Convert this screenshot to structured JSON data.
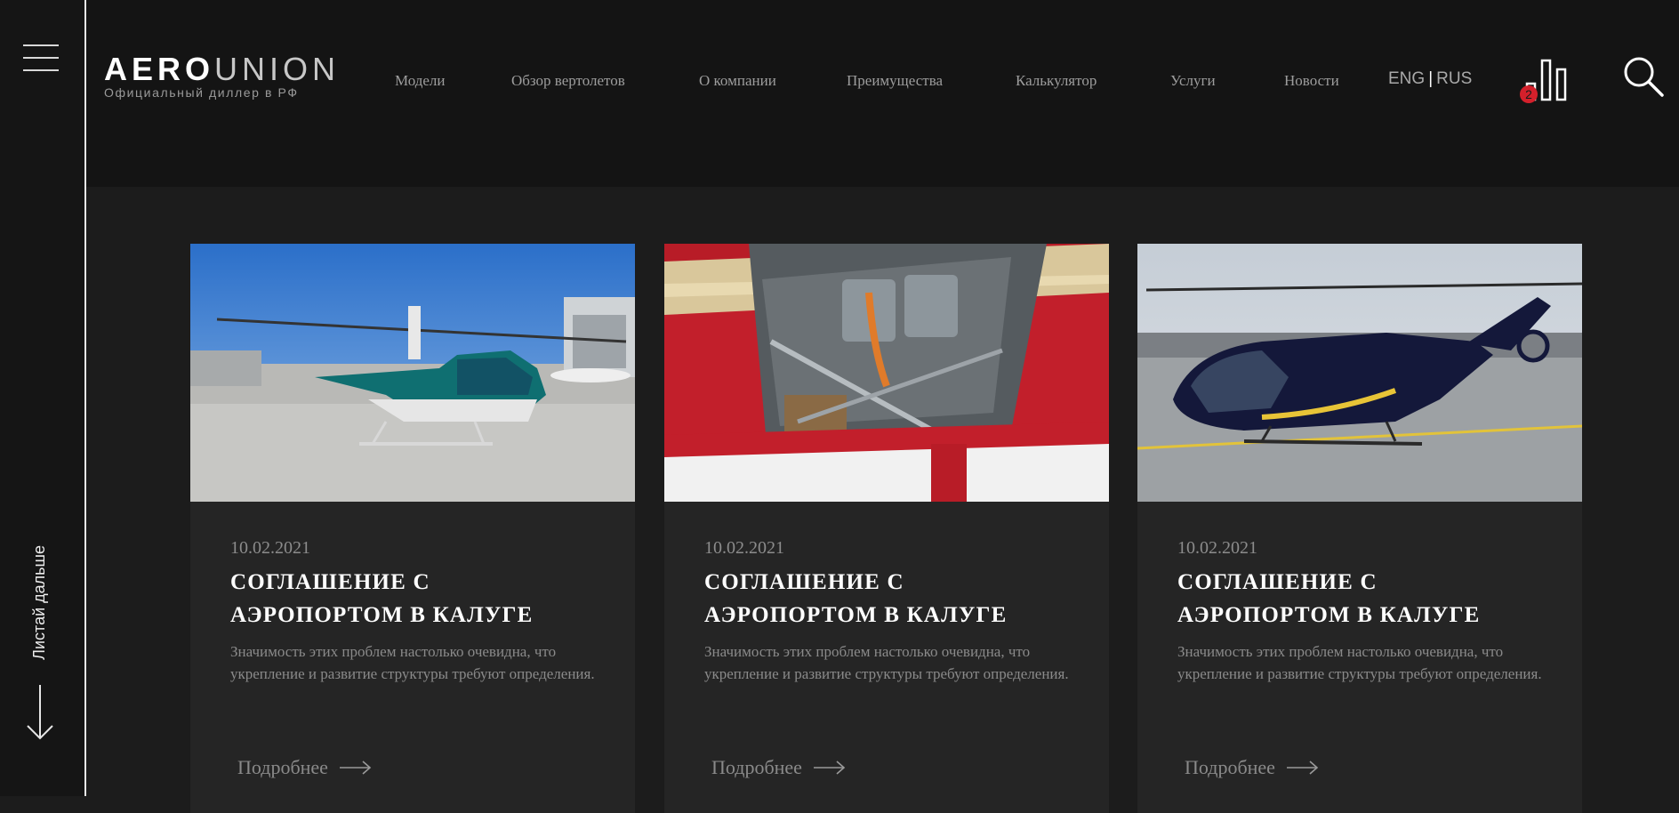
{
  "sidebar": {
    "scroll_label": "Листай дальше"
  },
  "header": {
    "logo": {
      "word_bold": "AERO",
      "word_light": "UNION",
      "subtitle": "Официальный диллер в РФ"
    },
    "nav": [
      {
        "label": "Модели"
      },
      {
        "label": "Обзор вертолетов"
      },
      {
        "label": "О компании"
      },
      {
        "label": "Преимущества"
      },
      {
        "label": "Калькулятор"
      },
      {
        "label": "Услуги"
      },
      {
        "label": "Новости"
      }
    ],
    "lang": {
      "eng": "ENG",
      "separator": "|",
      "rus": "RUS"
    },
    "compare": {
      "icon": "bar-chart-icon",
      "badge_count": "2",
      "badge_color": "#d4202b"
    },
    "search_icon": "search-icon"
  },
  "cards": [
    {
      "date": "10.02.2021",
      "title": "СОГЛАШЕНИЕ С АЭРОПОРТОМ В КАЛУГЕ",
      "text": "Значимость этих проблем настолько очевидна, что укрепление и развитие структуры требуют определения.",
      "more": "Подробнее"
    },
    {
      "date": "10.02.2021",
      "title": "СОГЛАШЕНИЕ С АЭРОПОРТОМ В КАЛУГЕ",
      "text": "Значимость этих проблем настолько очевидна, что укрепление и развитие структуры требуют определения.",
      "more": "Подробнее"
    },
    {
      "date": "10.02.2021",
      "title": "СОГЛАШЕНИЕ С АЭРОПОРТОМ В КАЛУГЕ",
      "text": "Значимость этих проблем настолько очевидна, что укрепление и развитие структуры требуют определения.",
      "more": "Подробнее"
    }
  ],
  "colors": {
    "background": "#1c1c1c",
    "card": "#252525",
    "text_muted": "#8a8a8a",
    "text_title": "#ffffff",
    "accent_badge": "#d4202b"
  }
}
